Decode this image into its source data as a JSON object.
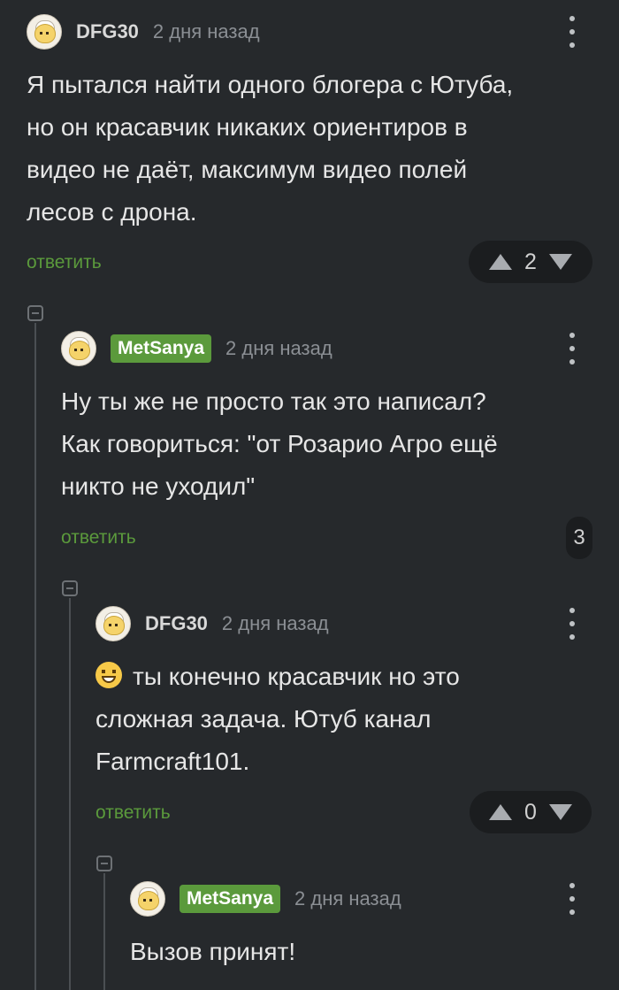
{
  "comments": [
    {
      "username": "DFG30",
      "time": "2 дня назад",
      "lines": [
        "Я пытался найти одного блогера с Ютуба,",
        "но он красавчик никаких ориентиров в",
        "видео не даёт, максимум видео полей",
        "лесов с дрона."
      ],
      "reply_label": "ответить",
      "votes": "2"
    },
    {
      "username": "MetSanya",
      "time": "2 дня назад",
      "lines": [
        "Ну ты же не просто так это написал?",
        "Как говориться: \"от Розарио Агро ещё",
        "никто не уходил\""
      ],
      "reply_label": "ответить",
      "replies_count": "3"
    },
    {
      "username": "DFG30",
      "time": "2 дня назад",
      "emoji": "grinning-face",
      "lines": [
        "ты конечно красавчик но это",
        "сложная задача. Ютуб канал",
        "Farmcraft101."
      ],
      "reply_label": "ответить",
      "votes": "0"
    },
    {
      "username": "MetSanya",
      "time": "2 дня назад",
      "lines": [
        "Вызов принят!"
      ]
    }
  ],
  "colors": {
    "background": "#26292c",
    "accent_green": "#5b9a3c",
    "vote_pill": "#1b1d1f"
  },
  "icons": [
    "avatar",
    "more-vertical-icon",
    "upvote-icon",
    "downvote-icon",
    "collapse-icon"
  ]
}
